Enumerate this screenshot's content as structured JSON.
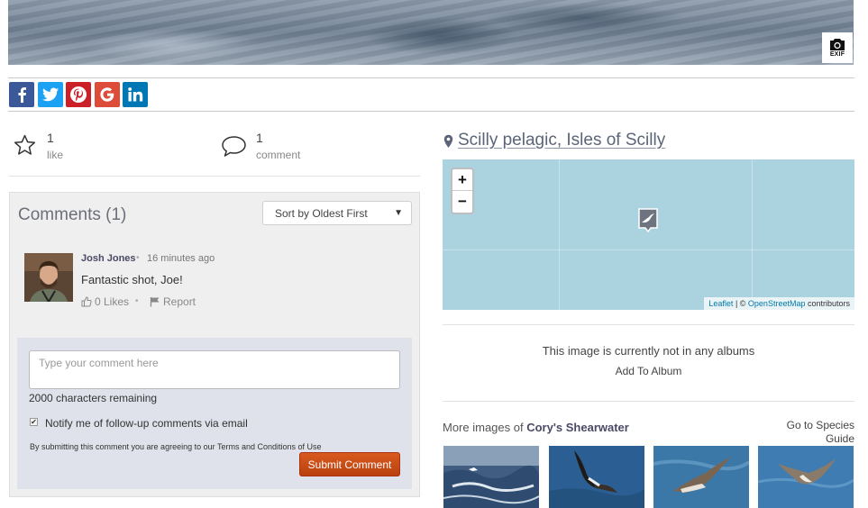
{
  "hero": {
    "exif_label": "EXIF"
  },
  "share": [
    {
      "network": "facebook",
      "glyph": "f",
      "color": "#3b5998"
    },
    {
      "network": "twitter",
      "glyph": "t",
      "color": "#1da1f2"
    },
    {
      "network": "pinterest",
      "glyph": "P",
      "color": "#cb2027"
    },
    {
      "network": "google",
      "glyph": "G",
      "color": "#dd4b39"
    },
    {
      "network": "linkedin",
      "glyph": "in",
      "color": "#0077b5"
    }
  ],
  "stats": {
    "likes": {
      "count": "1",
      "label": "like",
      "icon": "star-icon"
    },
    "comments": {
      "count": "1",
      "label": "comment",
      "icon": "speech-bubble-icon"
    }
  },
  "comments": {
    "title": "Comments (1)",
    "sort": {
      "selected": "Sort by Oldest First"
    },
    "items": [
      {
        "author": "Josh Jones",
        "time": "16 minutes ago",
        "text": "Fantastic shot, Joe!",
        "likes_label": "0 Likes",
        "report_label": "Report"
      }
    ],
    "form": {
      "placeholder": "Type your comment here",
      "chars_remaining": "2000 characters remaining",
      "notify_checked": true,
      "notify_label": "Notify me of follow-up comments via email",
      "terms_prefix": "By submitting this comment you are agreeing to our ",
      "terms_link": "Terms and Conditions of Use",
      "submit_label": "Submit Comment"
    }
  },
  "location": {
    "name": "Scilly pelagic, Isles of Scilly"
  },
  "map": {
    "zoom_in": "+",
    "zoom_out": "−",
    "attribution": {
      "leaflet": "Leaflet",
      "separator": " | © ",
      "osm": "OpenStreetMap",
      "suffix": " contributors"
    }
  },
  "albums": {
    "note": "This image is currently not in any albums",
    "add_label": "Add To Album"
  },
  "more": {
    "prefix": "More images of ",
    "species": "Cory's Shearwater",
    "guide_line1": "Go to Species",
    "guide_line2": "Guide"
  }
}
